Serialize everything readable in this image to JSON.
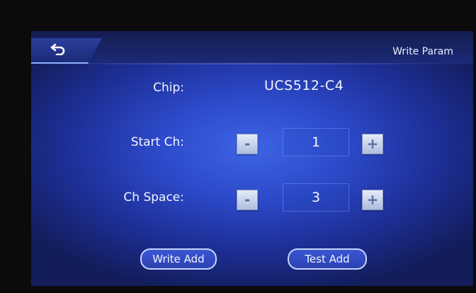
{
  "header": {
    "title": "Write Param",
    "back_icon": "undo-arrow-icon"
  },
  "chip": {
    "label": "Chip:",
    "value": "UCS512-C4"
  },
  "start_ch": {
    "label": "Start Ch:",
    "minus": "-",
    "value": "1",
    "plus": "+"
  },
  "ch_space": {
    "label": "Ch Space:",
    "minus": "-",
    "value": "3",
    "plus": "+"
  },
  "actions": {
    "write_add": "Write Add",
    "test_add": "Test Add"
  },
  "colors": {
    "background": "#2c49c8",
    "accent": "#8fb0ff",
    "button_face": "#e5ebf7"
  }
}
